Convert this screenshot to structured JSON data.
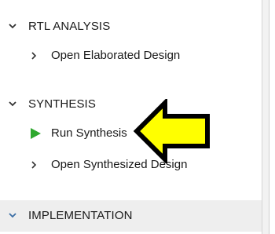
{
  "sections": {
    "rtl": {
      "label": "RTL ANALYSIS",
      "items": [
        {
          "label": "Open Elaborated Design"
        }
      ]
    },
    "synthesis": {
      "label": "SYNTHESIS",
      "items": [
        {
          "label": "Run Synthesis"
        },
        {
          "label": "Open Synthesized Design"
        }
      ]
    },
    "implementation": {
      "label": "IMPLEMENTATION"
    }
  },
  "colors": {
    "run_icon": "#2ea82e",
    "chevron": "#333333",
    "impl_chevron": "#3a6ea5",
    "arrow_fill": "#ffff00",
    "arrow_stroke": "#000000"
  },
  "icons": {
    "collapse": "chevron-down-icon",
    "expand": "chevron-right-icon",
    "run": "play-icon",
    "annotation": "left-arrow-icon"
  }
}
